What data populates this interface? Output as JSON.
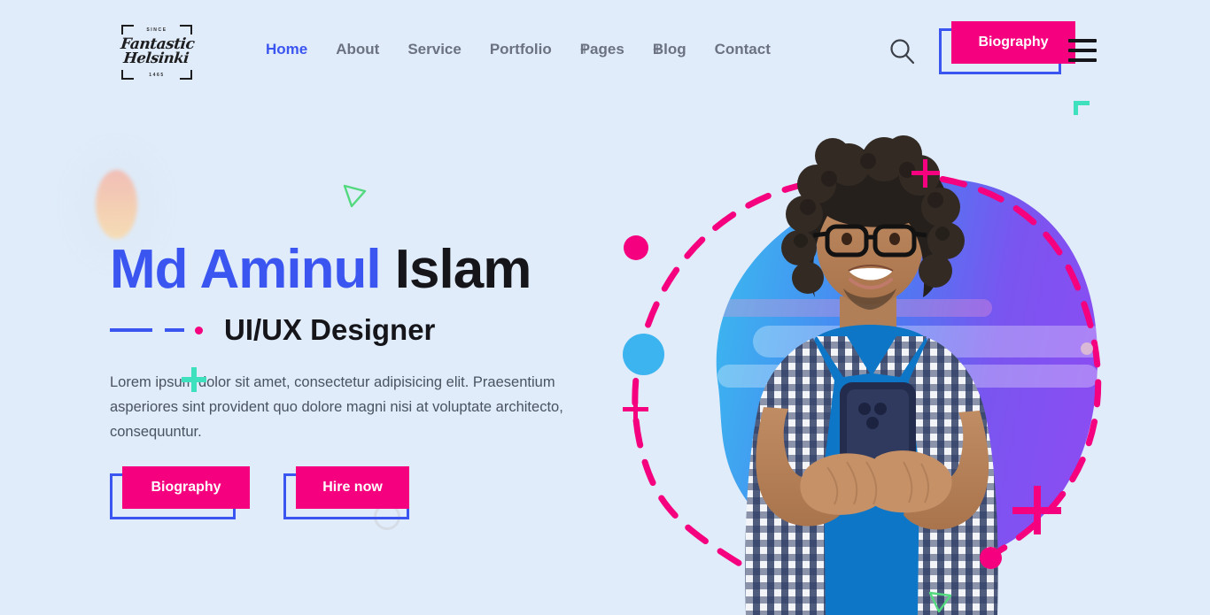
{
  "page": {
    "background_color": "#e0ecfa",
    "accent_blue": "#3b55f0",
    "accent_pink": "#f5007e",
    "accent_teal": "#3fe0bd",
    "text_dark": "#15151a",
    "text_gray": "#6b7280"
  },
  "header": {
    "logo": {
      "since_label": "SINCE",
      "year_label": "1465",
      "name_line1": "Fantastic",
      "name_line2": "Helsinki"
    },
    "nav_items": [
      {
        "label": "Home",
        "active": true,
        "has_plus": false
      },
      {
        "label": "About",
        "active": false,
        "has_plus": false
      },
      {
        "label": "Service",
        "active": false,
        "has_plus": false
      },
      {
        "label": "Portfolio",
        "active": false,
        "has_plus": false
      },
      {
        "label": "Pages",
        "active": false,
        "has_plus": true
      },
      {
        "label": "Blog",
        "active": false,
        "has_plus": true
      },
      {
        "label": "Contact",
        "active": false,
        "has_plus": false
      }
    ],
    "plus_glyph": "+",
    "search_icon": "search-icon",
    "biography_button": "Biography",
    "menu_icon": "hamburger-menu-icon"
  },
  "hero": {
    "title_blue": "Md Aminul",
    "title_dark": "Islam",
    "subtitle": "UI/UX Designer",
    "paragraph": "Lorem ipsum dolor sit amet, consectetur adipisicing elit. Praesentium asperiores sint provident quo dolore magni nisi at voluptate architecto, consequuntur.",
    "primary_button": "Biography",
    "secondary_button": "Hire now",
    "image_alt": "Smiling man with curly hair and glasses wearing a plaid shirt over a blue t-shirt, holding a smartphone"
  }
}
